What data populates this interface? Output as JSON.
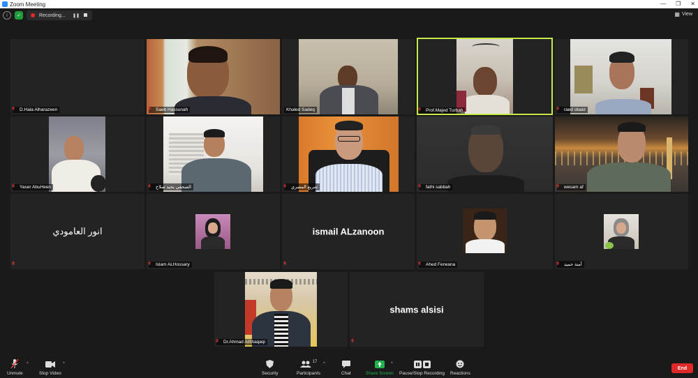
{
  "window": {
    "title": "Zoom Meeting",
    "buttons": [
      "—",
      "❐",
      "✕"
    ]
  },
  "topbar": {
    "recording_label": "Recording...",
    "view_label": "View"
  },
  "participants": [
    {
      "name": "D.Hala Alharazeen",
      "display_text": ""
    },
    {
      "name": "Saeb Hassunah",
      "display_text": ""
    },
    {
      "name": "Khaled Sadeq",
      "display_text": ""
    },
    {
      "name": "Prof.Majed Turbah",
      "display_text": ""
    },
    {
      "name": "raed obaid",
      "display_text": ""
    },
    {
      "name": "Yaser AbuHeen",
      "display_text": ""
    },
    {
      "name": "الصحفي يحيد صلاح",
      "display_text": ""
    },
    {
      "name": "شريع المصري",
      "display_text": ""
    },
    {
      "name": "fathi sabbah",
      "display_text": ""
    },
    {
      "name": "wesam af",
      "display_text": ""
    },
    {
      "name": "",
      "display_text": "انور العامودي"
    },
    {
      "name": "Islam ALHossary",
      "display_text": ""
    },
    {
      "name": "",
      "display_text": "ismail ALzanoon"
    },
    {
      "name": "Ahed Ferwana",
      "display_text": ""
    },
    {
      "name": "أمنة حميد",
      "display_text": ""
    },
    {
      "name": "Dr.Ahmad AlShaqaqi",
      "display_text": ""
    },
    {
      "name": "",
      "display_text": "shams alsisi"
    }
  ],
  "toolbar": {
    "unmute": "Unmute",
    "stop_video": "Stop Video",
    "security": "Security",
    "participants": "Participants",
    "participants_count": "17",
    "chat": "Chat",
    "share_screen": "Share Screen",
    "pause_stop_recording": "Pause/Stop Recording",
    "reactions": "Reactions",
    "end": "End"
  },
  "colors": {
    "active_speaker": "#c8e84a",
    "share_green": "#22b14c",
    "end_red": "#e02828",
    "mute_red": "#e53935"
  }
}
